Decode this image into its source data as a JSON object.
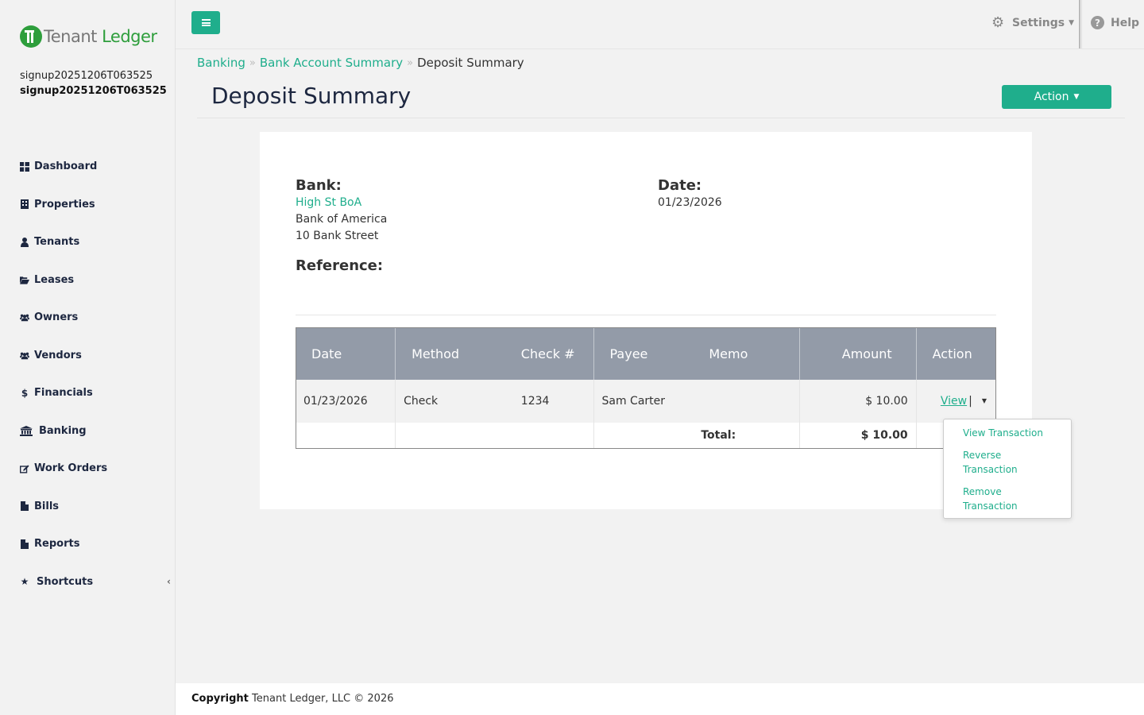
{
  "brand": {
    "name_part1": "Tenant",
    "name_part2": "Ledger",
    "accent": "#1fae8c",
    "logo_green": "#2e9e3c"
  },
  "user": {
    "line1": "signup20251206T063525",
    "line2": "signup20251206T063525"
  },
  "sidebar": {
    "items": [
      {
        "label": "Dashboard",
        "icon": "dashboard-icon"
      },
      {
        "label": "Properties",
        "icon": "building-icon"
      },
      {
        "label": "Tenants",
        "icon": "user-icon"
      },
      {
        "label": "Leases",
        "icon": "folder-open-icon"
      },
      {
        "label": "Owners",
        "icon": "users-icon"
      },
      {
        "label": "Vendors",
        "icon": "users-icon"
      },
      {
        "label": "Financials",
        "icon": "dollar-icon"
      },
      {
        "label": "Banking",
        "icon": "bank-icon"
      },
      {
        "label": "Work Orders",
        "icon": "edit-icon"
      },
      {
        "label": "Bills",
        "icon": "file-icon"
      },
      {
        "label": "Reports",
        "icon": "file-icon"
      },
      {
        "label": "Shortcuts",
        "icon": "star-icon"
      }
    ]
  },
  "topbar": {
    "settings_label": "Settings",
    "help_label": "Help"
  },
  "breadcrumb": {
    "items": [
      "Banking",
      "Bank Account Summary"
    ],
    "current": "Deposit Summary"
  },
  "page": {
    "title": "Deposit Summary",
    "action_label": "Action"
  },
  "deposit": {
    "bank_label": "Bank:",
    "bank_name": "High St BoA",
    "bank_institution": "Bank of America",
    "bank_address": "10 Bank Street",
    "date_label": "Date:",
    "date_value": "01/23/2026",
    "reference_label": "Reference:"
  },
  "table": {
    "headers": [
      "Date",
      "Method",
      "Check #",
      "Payee",
      "Memo",
      "Amount",
      "Action"
    ],
    "rows": [
      {
        "date": "01/23/2026",
        "method": "Check",
        "check": "1234",
        "payee": "Sam Carter",
        "memo": "",
        "amount": "$ 10.00",
        "action": "View"
      }
    ],
    "total_label": "Total:",
    "total_value": "$ 10.00"
  },
  "dropdown": {
    "items": [
      "View Transaction",
      "Reverse Transaction",
      "Remove Transaction"
    ]
  },
  "footer": {
    "copyright_label": "Copyright",
    "text": "Tenant Ledger, LLC © 2026"
  }
}
